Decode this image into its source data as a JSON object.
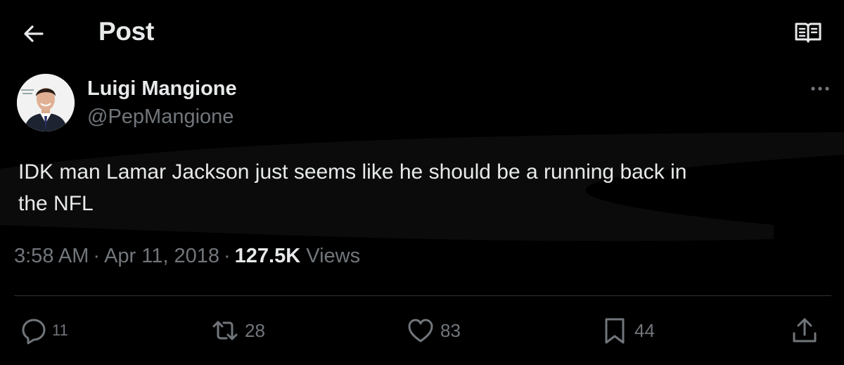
{
  "header": {
    "title": "Post",
    "back_icon": "arrow-left-icon",
    "reader_icon": "open-book-icon"
  },
  "author": {
    "display_name": "Luigi Mangione",
    "handle": "@PepMangione",
    "avatar_icon": "profile-photo",
    "more_icon": "more-dots-icon"
  },
  "tweet": {
    "text": "IDK man Lamar Jackson just seems like he should be a running back in the NFL"
  },
  "meta": {
    "time": "3:58 AM",
    "date": "Apr 11, 2018",
    "views_count": "127.5K",
    "views_label": "Views",
    "separator": "·"
  },
  "actions": {
    "replies": "11",
    "reposts": "28",
    "likes": "83",
    "bookmarks": "44"
  },
  "colors": {
    "background": "#000000",
    "primary_text": "#e7e9ea",
    "secondary_text": "#71767b",
    "divider": "#2f3336"
  }
}
